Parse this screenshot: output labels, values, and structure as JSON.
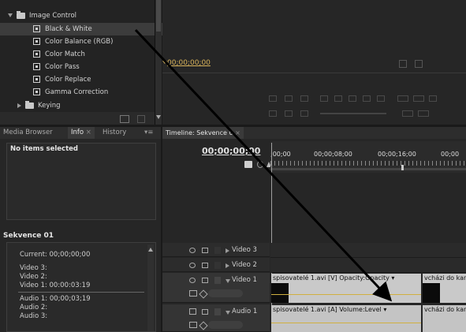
{
  "effects": {
    "folders": [
      {
        "label": "Image Control",
        "expanded": true
      },
      {
        "label": "Keying",
        "expanded": false
      }
    ],
    "items": [
      {
        "label": "Black & White",
        "selected": true
      },
      {
        "label": "Color Balance (RGB)",
        "selected": false
      },
      {
        "label": "Color Match",
        "selected": false
      },
      {
        "label": "Color Pass",
        "selected": false
      },
      {
        "label": "Color Replace",
        "selected": false
      },
      {
        "label": "Gamma Correction",
        "selected": false
      }
    ]
  },
  "monitor": {
    "timecode": "00;00;00;00"
  },
  "panel_tabs": {
    "media_browser": "Media Browser",
    "info": "Info",
    "history": "History"
  },
  "info": {
    "no_items": "No items selected",
    "sequence_title": "Sekvence 01",
    "lines": [
      "Current: 00;00;00;00",
      "Video 3:",
      "Video 2:",
      "Video 1:  00:00:03:19",
      "Audio 1:  00;00;03;19",
      "Audio 2:",
      "Audio 3:"
    ]
  },
  "timeline": {
    "tab_label": "Timeline: Sekvence 0",
    "timecode": "00;00;00;00",
    "ruler_labels": [
      ";00;00",
      "00;00;08;00",
      "00;00;16;00",
      "00;00"
    ],
    "tracks": [
      {
        "name": "Video 3",
        "expanded": false
      },
      {
        "name": "Video 2",
        "expanded": false
      },
      {
        "name": "Video 1",
        "expanded": true
      },
      {
        "name": "Audio 1",
        "expanded": true
      }
    ],
    "clips": {
      "video1_a": "spisovatelé 1.avi [V]  Opacity:Opacity ▾",
      "video1_b": "vcházi do kan",
      "audio1_a": "spisovatelé 1.avi [A]  Volume:Level ▾",
      "audio1_b": "vcházi do kan"
    }
  },
  "colors": {
    "panel_bg": "#262626",
    "selection": "#3c3c3c",
    "clip_bg": "#c9c9c9",
    "arrow": "#000000"
  }
}
